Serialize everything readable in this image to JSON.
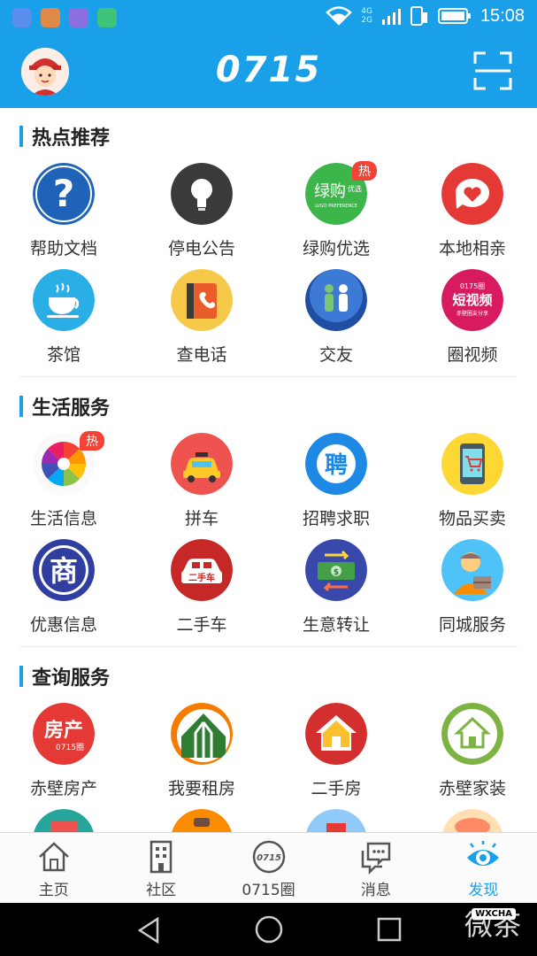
{
  "status_bar": {
    "time": "15:08",
    "network": [
      "4G",
      "2G"
    ]
  },
  "header": {
    "logo": "0715"
  },
  "sections": [
    {
      "title": "热点推荐",
      "items": [
        {
          "label": "帮助文档",
          "icon": "question-icon"
        },
        {
          "label": "停电公告",
          "icon": "lightbulb-icon"
        },
        {
          "label": "绿购优选",
          "icon": "green-shop-icon",
          "badge": "热",
          "icon_text": "绿购",
          "icon_small": "优选",
          "icon_sub": "LVGO PREFERENCE"
        },
        {
          "label": "本地相亲",
          "icon": "heart-chat-icon"
        },
        {
          "label": "茶馆",
          "icon": "teacup-icon"
        },
        {
          "label": "查电话",
          "icon": "phonebook-icon"
        },
        {
          "label": "交友",
          "icon": "people-icon"
        },
        {
          "label": "圈视频",
          "icon": "video-icon",
          "icon_top": "0175圈",
          "icon_text": "短视频",
          "icon_sub": "赤壁圈友分享"
        }
      ]
    },
    {
      "title": "生活服务",
      "items": [
        {
          "label": "生活信息",
          "icon": "pinwheel-icon",
          "badge": "热"
        },
        {
          "label": "拼车",
          "icon": "taxi-icon"
        },
        {
          "label": "招聘求职",
          "icon": "recruit-icon",
          "icon_text": "聘"
        },
        {
          "label": "物品买卖",
          "icon": "cart-phone-icon"
        },
        {
          "label": "优惠信息",
          "icon": "merchant-icon",
          "icon_text": "商"
        },
        {
          "label": "二手车",
          "icon": "used-car-icon",
          "icon_text": "二手车"
        },
        {
          "label": "生意转让",
          "icon": "money-transfer-icon"
        },
        {
          "label": "同城服务",
          "icon": "courier-icon"
        }
      ]
    },
    {
      "title": "查询服务",
      "items": [
        {
          "label": "赤壁房产",
          "icon": "real-estate-icon",
          "icon_text": "房产",
          "icon_sub": "0715圈"
        },
        {
          "label": "我要租房",
          "icon": "rent-house-icon"
        },
        {
          "label": "二手房",
          "icon": "second-house-icon"
        },
        {
          "label": "赤壁家装",
          "icon": "home-decor-icon"
        }
      ]
    }
  ],
  "bottom_nav": [
    {
      "label": "主页",
      "icon": "home-icon"
    },
    {
      "label": "社区",
      "icon": "building-icon"
    },
    {
      "label": "0715圈",
      "icon": "circle-logo-icon"
    },
    {
      "label": "消息",
      "icon": "message-icon"
    },
    {
      "label": "发现",
      "icon": "eye-icon",
      "active": true
    }
  ],
  "watermark": {
    "text": "微茶",
    "badge": "WXCHA"
  },
  "colors": {
    "primary": "#1aa0e8",
    "hot_badge": "#f44336"
  }
}
